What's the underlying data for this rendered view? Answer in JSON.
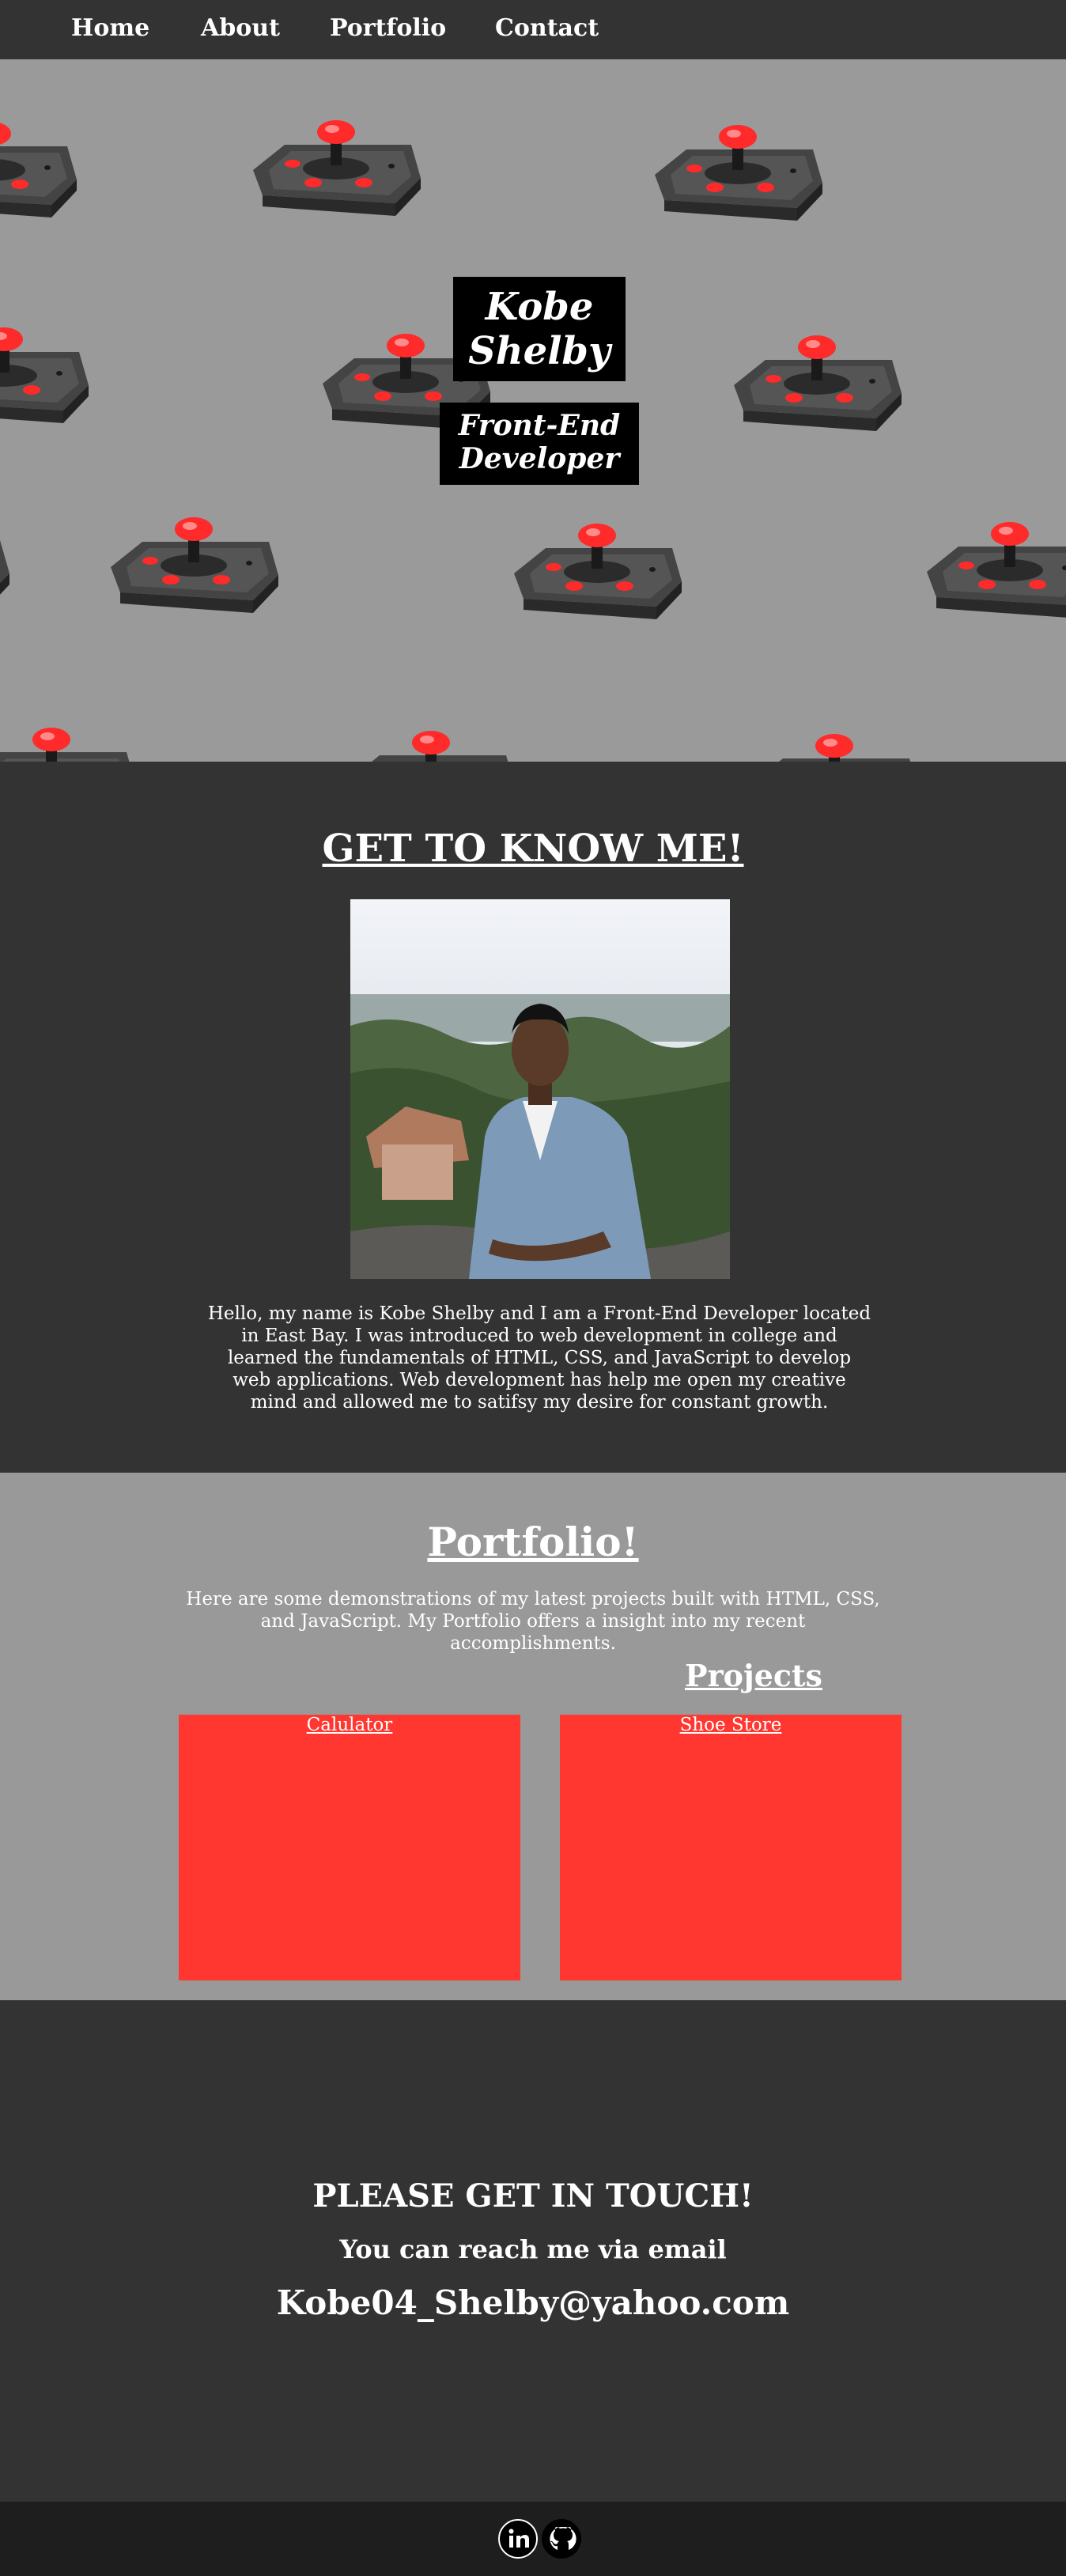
{
  "nav": {
    "home": "Home",
    "about": "About",
    "portfolio": "Portfolio",
    "contact": "Contact"
  },
  "hero": {
    "name_line1": "Kobe",
    "name_line2": "Shelby",
    "role_line1": "Front-End",
    "role_line2": "Developer"
  },
  "about": {
    "heading": "GET TO KNOW ME!",
    "bio": "Hello, my name is Kobe Shelby and I am a Front-End Developer located in East Bay. I was introduced to web development in college and learned the fundamentals of HTML, CSS, and JavaScript to develop web applications. Web development has help me open my creative mind and allowed me to satifsy my desire for constant growth."
  },
  "portfolio": {
    "heading": "Portfolio!",
    "intro": "Here are some demonstrations of my latest projects built with HTML, CSS, and JavaScript. My Portfolio offers a insight into my recent accomplishments.",
    "projects_heading": "Projects",
    "projects": [
      {
        "title": "Calulator"
      },
      {
        "title": "Shoe Store"
      }
    ]
  },
  "contact": {
    "heading": "PLEASE GET IN TOUCH!",
    "subheading": "You can reach me via email",
    "email": "Kobe04_Shelby@yahoo.com"
  },
  "footer": {
    "icons": [
      "linkedin-icon",
      "github-icon"
    ]
  },
  "colors": {
    "dark": "#333333",
    "hero_bg": "#9a9a9a",
    "portfolio_bg": "#999999",
    "card": "#ff3730",
    "footer": "#1e1e1e"
  }
}
